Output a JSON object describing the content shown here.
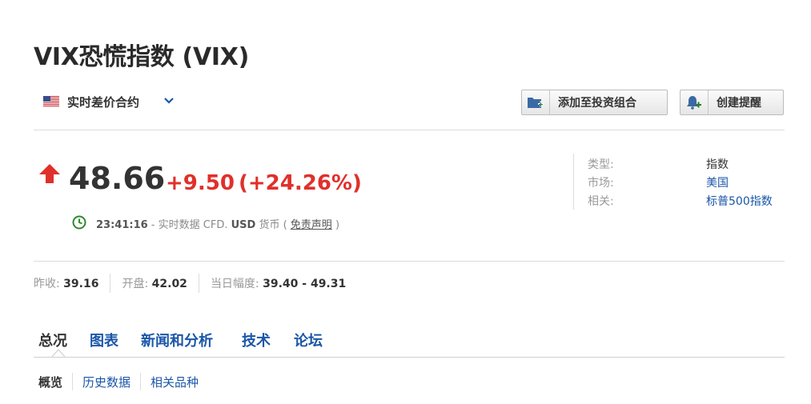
{
  "header": {
    "title": "VIX恐慌指数 (VIX)"
  },
  "instrument": {
    "flag_icon": "us-flag-icon",
    "type_label": "实时差价合约"
  },
  "actions": {
    "add_portfolio_label": "添加至投资组合",
    "create_alert_label": "创建提醒"
  },
  "quote": {
    "last": "48.66",
    "change": "+9.50",
    "change_pct": "(+24.26%)",
    "direction": "up",
    "time": "23:41:16",
    "sep1": " - 实时数据 CFD. ",
    "currency": "USD",
    "currency_suffix": " 货币 ( ",
    "disclaimer": "免责声明",
    "close_paren": " )"
  },
  "info": {
    "type_label": "类型:",
    "type_value": "指数",
    "market_label": "市场:",
    "market_value": "美国",
    "related_label": "相关:",
    "related_value": "标普500指数"
  },
  "stats": {
    "prev_close_label": "昨收:",
    "prev_close_value": "39.16",
    "open_label": "开盘:",
    "open_value": "42.02",
    "day_range_label": "当日幅度:",
    "day_range_value": "39.40 - 49.31"
  },
  "tabs": [
    {
      "label": "总况"
    },
    {
      "label": "图表"
    },
    {
      "label": "新闻和分析"
    },
    {
      "label": "技术"
    },
    {
      "label": "论坛"
    }
  ],
  "subnav": [
    {
      "label": "概览"
    },
    {
      "label": "历史数据"
    },
    {
      "label": "相关品种"
    }
  ],
  "colors": {
    "up": "#e0302b",
    "link": "#1a56a8",
    "clock": "#2e8b2e"
  }
}
